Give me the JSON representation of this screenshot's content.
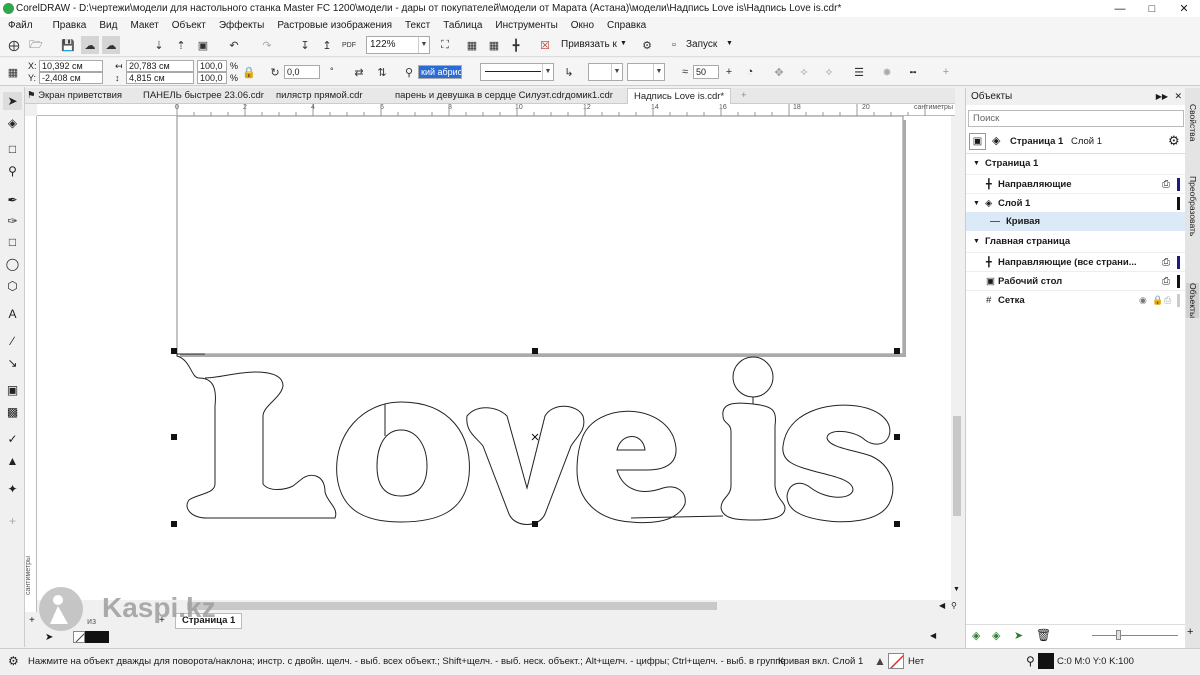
{
  "title": "CorelDRAW - D:\\чертежи\\модели для настольного станка Master FC 1200\\модели - дары от покупателей\\модели от Марата (Астана)\\модели\\Надпись Love is\\Надпись Love is.cdr*",
  "menu": [
    "Файл",
    "Правка",
    "Вид",
    "Макет",
    "Объект",
    "Эффекты",
    "Растровые изображения",
    "Текст",
    "Таблица",
    "Инструменты",
    "Окно",
    "Справка"
  ],
  "toolbar": {
    "zoom": "122%",
    "snap_label": "Привязать к",
    "launch_label": "Запуск"
  },
  "propbar": {
    "x_label": "X:",
    "x_value": "10,392 см",
    "y_label": "Y:",
    "y_value": "-2,408 см",
    "w_value": "20,783 см",
    "h_value": "4,815 см",
    "sx_value": "100,0",
    "sy_value": "100,0",
    "pct": "%",
    "angle_value": "0,0",
    "angle_unit": "°",
    "outline_width": "кий абрис",
    "smooth_value": "50"
  },
  "tabs": [
    "Экран приветствия",
    "ПАНЕЛЬ быстрее 23.06.cdr",
    "пилястр прямой.cdr",
    "парень и девушка в сердце Силуэт.cdr",
    "домик1.cdr",
    "Надпись Love is.cdr*"
  ],
  "ruler": {
    "h_ticks": [
      "0",
      "2",
      "4",
      "6",
      "8",
      "10",
      "12",
      "14",
      "16",
      "18",
      "20"
    ],
    "unit": "сантиметры",
    "v_unit": "сантиметры"
  },
  "page_nav": {
    "of": "из",
    "page_label": "Страница 1"
  },
  "status": {
    "hint": "Нажмите на объект дважды для поворота/наклона; инстр. с двойн. щелч. - выб. всех объект.; Shift+щелч. - выб. неск. объект.; Alt+щелч. - цифры; Ctrl+щелч. - выб. в группе",
    "object_info": "Кривая вкл. Слой 1",
    "fill_label": "Нет",
    "outline_color": "C:0 M:0 Y:0 K:100"
  },
  "docker": {
    "title": "Объекты",
    "search_placeholder": "Поиск",
    "page_label": "Страница 1",
    "layer_label": "Слой 1",
    "rows": [
      {
        "label": "Страница 1"
      },
      {
        "label": "Направляющие"
      },
      {
        "label": "Слой 1"
      },
      {
        "label": "Кривая"
      },
      {
        "label": "Главная страница"
      },
      {
        "label": "Направляющие (все страни..."
      },
      {
        "label": "Рабочий стол"
      },
      {
        "label": "Сетка"
      }
    ]
  },
  "side_tabs": [
    "Свойства",
    "Преобразовать",
    "Объекты"
  ],
  "canvas": {
    "shape_text": "Love is"
  },
  "watermark": "Kaspi.kz",
  "colors": {
    "accent": "#2b6cd4",
    "selection": "#dce9f7",
    "layer_marker": "#1a1a8c"
  }
}
